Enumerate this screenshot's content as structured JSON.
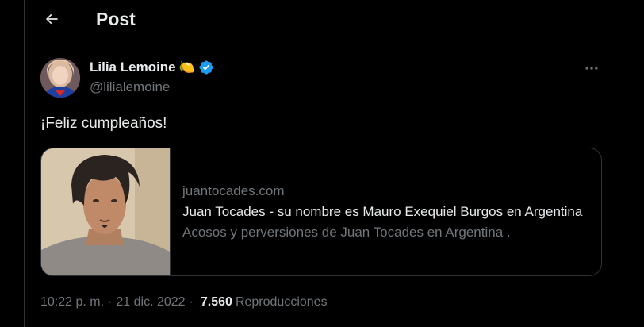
{
  "header": {
    "title": "Post"
  },
  "author": {
    "name": "Lilia Lemoine",
    "emoji": "🍋",
    "handle": "@lilialemoine"
  },
  "tweet": {
    "text": "¡Feliz cumpleaños!"
  },
  "card": {
    "domain": "juantocades.com",
    "title": "Juan Tocades - su nombre es Mauro Exequiel Burgos en Argentina",
    "description": "Acosos y perversiones de Juan Tocades en Argentina ."
  },
  "meta": {
    "time": "10:22 p. m.",
    "separator": "·",
    "date": "21 dic. 2022",
    "views": "7.560",
    "views_label": "Reproducciones"
  },
  "colors": {
    "background": "#000000",
    "text": "#e7e9ea",
    "muted": "#71767b",
    "border": "#2f3336",
    "verified": "#1d9bf0"
  },
  "icons": {
    "back": "arrow-left-icon",
    "verified": "verified-badge-icon",
    "more": "more-horizontal-icon"
  }
}
